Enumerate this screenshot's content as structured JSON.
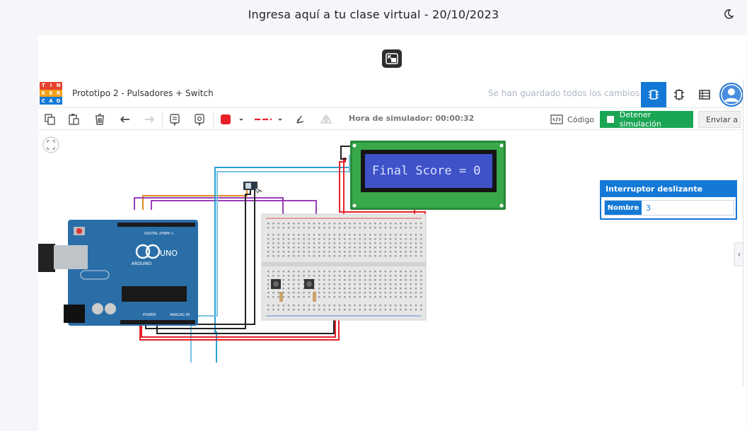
{
  "page": {
    "title": "Ingresa aquí a tu clase virtual - 20/10/2023"
  },
  "icons": {
    "theme_toggle": "moon-icon",
    "restore": "restore-window-icon"
  },
  "tinkercad": {
    "logo_letters": [
      "T",
      "I",
      "N",
      "K",
      "E",
      "R",
      "C",
      "A",
      "D"
    ],
    "logo_colors": [
      "#e8412c",
      "#e8412c",
      "#e8412c",
      "#f2a019",
      "#f2a019",
      "#f2a019",
      "#1479d6",
      "#1479d6",
      "#1479d6"
    ],
    "project_title": "Prototipo 2 - Pulsadores + Switch",
    "save_status": "Se han guardado todos los cambios.",
    "views": [
      "circuit-view-icon",
      "schematic-view-icon",
      "component-list-icon"
    ],
    "toolbar": {
      "simulator_time": "Hora de simulador: 00:00:32",
      "code_label": "Código",
      "stop_label": "Detener simulación",
      "send_label": "Enviar a",
      "color_red": "#e8202a"
    },
    "inspector": {
      "title": "Interruptor deslizante",
      "field_label": "Nombre",
      "field_value": "3"
    },
    "lcd": {
      "text": "Final Score = 0"
    },
    "arduino": {
      "brand": "ARDUINO",
      "model": "UNO",
      "digital_label": "DIGITAL (PWM~)",
      "power_label": "POWER",
      "analog_label": "ANALOG IN"
    }
  }
}
